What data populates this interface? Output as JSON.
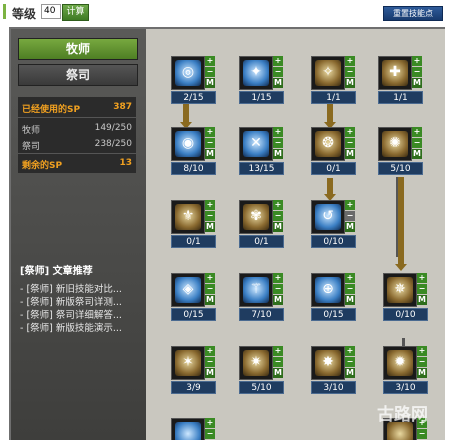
{
  "header": {
    "level_label": "等级",
    "level_value": "40",
    "calc_label": "计算",
    "reset_label": "重置技能点"
  },
  "jobs": {
    "primary": "牧师",
    "secondary": "祭司"
  },
  "sp": {
    "used_label": "已经使用的SP",
    "used_value": "387",
    "row1_label": "牧师",
    "row1_value": "149/250",
    "row2_label": "祭司",
    "row2_value": "238/250",
    "remain_label": "剩余的SP",
    "remain_value": "13"
  },
  "recommend": {
    "title": "[祭师] 文章推荐",
    "items": [
      "- [祭师] 新旧技能对比...",
      "- [祭师] 新版祭司详测...",
      "- [祭师] 祭司详细解答...",
      "- [祭师] 新版技能演示..."
    ]
  },
  "skills": [
    {
      "count": "2/15",
      "glyph": "◎",
      "tone": "blue"
    },
    {
      "count": "1/15",
      "glyph": "✦",
      "tone": "blue"
    },
    {
      "count": "1/1",
      "glyph": "✧",
      "tone": "gold"
    },
    {
      "count": "1/1",
      "glyph": "✚",
      "tone": "gold"
    },
    {
      "count": "8/10",
      "glyph": "◉",
      "tone": "blue"
    },
    {
      "count": "13/15",
      "glyph": "✕",
      "tone": "blue"
    },
    {
      "count": "0/1",
      "glyph": "❂",
      "tone": "gold"
    },
    {
      "count": "5/10",
      "glyph": "✺",
      "tone": "gold"
    },
    {
      "count": "0/1",
      "glyph": "⚜",
      "tone": "gold"
    },
    {
      "count": "0/1",
      "glyph": "✾",
      "tone": "gold"
    },
    {
      "count": "0/10",
      "glyph": "↺",
      "tone": "blue"
    },
    {
      "count": "0/15",
      "glyph": "◈",
      "tone": "blue"
    },
    {
      "count": "7/10",
      "glyph": "⚚",
      "tone": "blue"
    },
    {
      "count": "0/15",
      "glyph": "⊕",
      "tone": "blue"
    },
    {
      "count": "0/10",
      "glyph": "✵",
      "tone": "gold"
    },
    {
      "count": "3/9",
      "glyph": "✶",
      "tone": "gold"
    },
    {
      "count": "5/10",
      "glyph": "✷",
      "tone": "gold"
    },
    {
      "count": "3/10",
      "glyph": "✸",
      "tone": "gold"
    },
    {
      "count": "3/10",
      "glyph": "✹",
      "tone": "gold"
    }
  ],
  "watermark": "古路网"
}
